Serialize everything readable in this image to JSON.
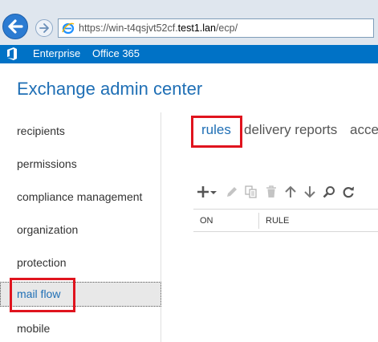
{
  "browser": {
    "url_prefix": "https://win-t4qsjvt52cf.",
    "url_host": "test1.lan",
    "url_suffix": "/ecp/"
  },
  "navbar": {
    "items": [
      "Enterprise",
      "Office 365"
    ]
  },
  "page": {
    "title": "Exchange admin center"
  },
  "leftnav": {
    "items": [
      "recipients",
      "permissions",
      "compliance management",
      "organization",
      "protection",
      "mail flow",
      "mobile"
    ],
    "selected": "mail flow"
  },
  "tabs": [
    "rules",
    "delivery reports",
    "acce"
  ],
  "toolbar": {
    "icons": [
      "plus-icon",
      "dropdown-arrow-icon",
      "edit-icon",
      "copy-icon",
      "delete-icon",
      "move-up-icon",
      "move-down-icon",
      "search-icon",
      "refresh-icon"
    ]
  },
  "grid": {
    "columns": [
      "ON",
      "RULE"
    ]
  },
  "colors": {
    "brand_blue": "#0072c6",
    "title_blue": "#1f6fb5",
    "highlight_red": "#e0141e"
  }
}
